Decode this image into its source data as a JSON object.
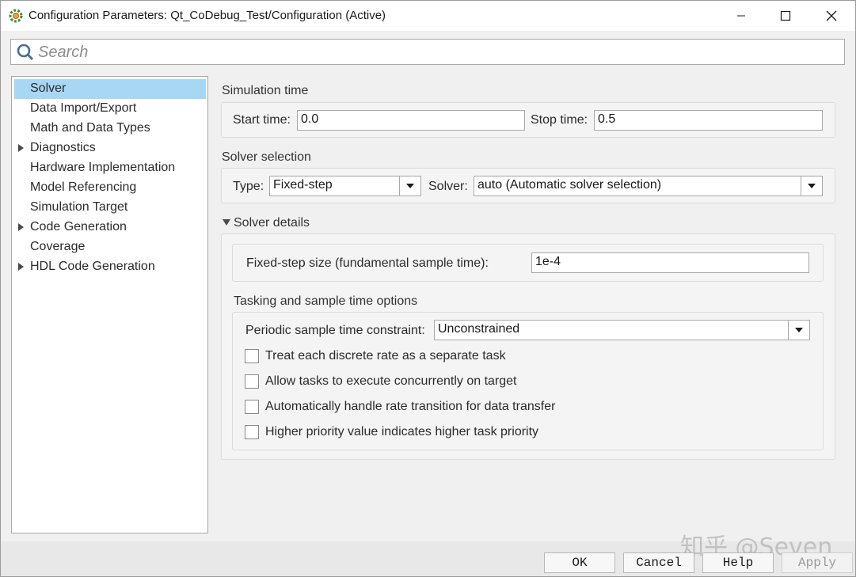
{
  "window": {
    "title": "Configuration Parameters: Qt_CoDebug_Test/Configuration (Active)",
    "icon": "gear-icon"
  },
  "search": {
    "placeholder": "Search",
    "value": ""
  },
  "tree": {
    "items": [
      {
        "label": "Solver",
        "expandable": false,
        "selected": true
      },
      {
        "label": "Data Import/Export",
        "expandable": false
      },
      {
        "label": "Math and Data Types",
        "expandable": false
      },
      {
        "label": "Diagnostics",
        "expandable": true
      },
      {
        "label": "Hardware Implementation",
        "expandable": false
      },
      {
        "label": "Model Referencing",
        "expandable": false
      },
      {
        "label": "Simulation Target",
        "expandable": false
      },
      {
        "label": "Code Generation",
        "expandable": true
      },
      {
        "label": "Coverage",
        "expandable": false
      },
      {
        "label": "HDL Code Generation",
        "expandable": true
      }
    ]
  },
  "simulation_time": {
    "title": "Simulation time",
    "start_label": "Start time:",
    "start_value": "0.0",
    "stop_label": "Stop time:",
    "stop_value": "0.5"
  },
  "solver_selection": {
    "title": "Solver selection",
    "type_label": "Type:",
    "type_value": "Fixed-step",
    "solver_label": "Solver:",
    "solver_value": "auto (Automatic solver selection)"
  },
  "solver_details": {
    "title": "Solver details",
    "step_size_label": "Fixed-step size (fundamental sample time):",
    "step_size_value": "1e-4"
  },
  "tasking": {
    "title": "Tasking and sample time options",
    "constraint_label": "Periodic sample time constraint:",
    "constraint_value": "Unconstrained",
    "checkboxes": [
      {
        "label": "Treat each discrete rate as a separate task",
        "checked": false
      },
      {
        "label": "Allow tasks to execute concurrently on target",
        "checked": false
      },
      {
        "label": "Automatically handle rate transition for data transfer",
        "checked": false
      },
      {
        "label": "Higher priority value indicates higher task priority",
        "checked": false
      }
    ]
  },
  "buttons": {
    "ok": "OK",
    "cancel": "Cancel",
    "help": "Help",
    "apply": "Apply"
  },
  "watermark": "知乎 @Seven"
}
